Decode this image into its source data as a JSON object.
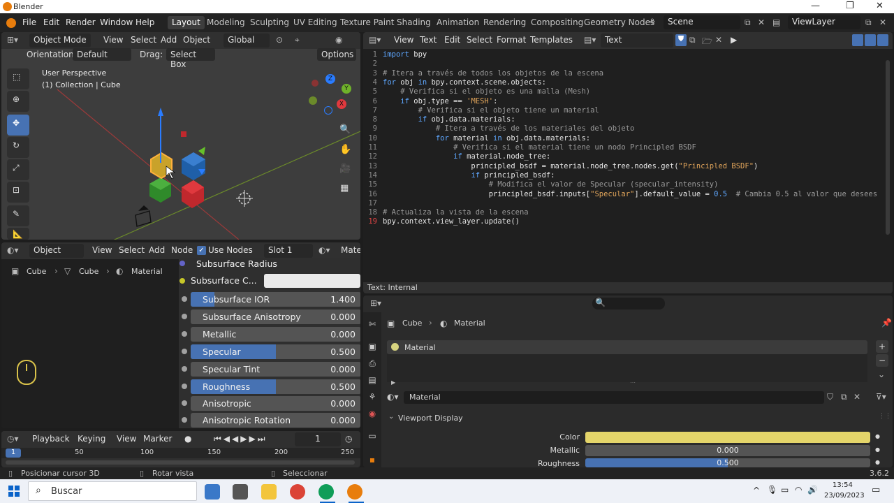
{
  "window": {
    "title": "Blender",
    "minimize": "—",
    "maximize": "❐",
    "close": "✕"
  },
  "topbar": {
    "menus": [
      "File",
      "Edit",
      "Render",
      "Window",
      "Help"
    ],
    "workspaces": [
      "Layout",
      "Modeling",
      "Sculpting",
      "UV Editing",
      "Texture Paint",
      "Shading",
      "Animation",
      "Rendering",
      "Compositing",
      "Geometry Nodes"
    ],
    "scene": "Scene",
    "view_layer": "ViewLayer"
  },
  "viewport": {
    "mode": "Object Mode",
    "menus": [
      "View",
      "Select",
      "Add",
      "Object"
    ],
    "transform": "Global",
    "orientation_label": "Orientation:",
    "orientation": "Default",
    "drag_label": "Drag:",
    "drag": "Select Box",
    "options": "Options",
    "perspective": "User Perspective",
    "collection": "(1) Collection | Cube",
    "gizmo_axes": [
      "Z",
      "Y",
      "X"
    ]
  },
  "text_editor": {
    "menus": [
      "View",
      "Text",
      "Edit",
      "Select",
      "Format",
      "Templates"
    ],
    "datablock": "Text",
    "footer": "Text: Internal",
    "lines": [
      {
        "n": "1",
        "t": "import bpy"
      },
      {
        "n": "2",
        "t": ""
      },
      {
        "n": "3",
        "t": "# Itera a través de todos los objetos de la escena"
      },
      {
        "n": "4",
        "t": "for obj in bpy.context.scene.objects:"
      },
      {
        "n": "5",
        "t": "    # Verifica si el objeto es una malla (Mesh)"
      },
      {
        "n": "6",
        "t": "    if obj.type == 'MESH':"
      },
      {
        "n": "7",
        "t": "        # Verifica si el objeto tiene un material"
      },
      {
        "n": "8",
        "t": "        if obj.data.materials:"
      },
      {
        "n": "9",
        "t": "            # Itera a través de los materiales del objeto"
      },
      {
        "n": "10",
        "t": "            for material in obj.data.materials:"
      },
      {
        "n": "11",
        "t": "                # Verifica si el material tiene un nodo Principled BSDF"
      },
      {
        "n": "12",
        "t": "                if material.node_tree:"
      },
      {
        "n": "13",
        "t": "                    principled_bsdf = material.node_tree.nodes.get(\"Principled BSDF\")"
      },
      {
        "n": "14",
        "t": "                    if principled_bsdf:"
      },
      {
        "n": "15",
        "t": "                        # Modifica el valor de Specular (specular_intensity)"
      },
      {
        "n": "16",
        "t": "                        principled_bsdf.inputs[\"Specular\"].default_value = 0.5  # Cambia 0.5 al valor que desees"
      },
      {
        "n": "17",
        "t": ""
      },
      {
        "n": "18",
        "t": "# Actualiza la vista de la escena"
      },
      {
        "n": "19",
        "t": "bpy.context.view_layer.update()"
      }
    ]
  },
  "node_editor": {
    "object": "Object",
    "menus": [
      "View",
      "Select",
      "Add",
      "Node"
    ],
    "use_nodes": "Use Nodes",
    "slot": "Slot 1",
    "material_short": "Mater",
    "breadcrumb": [
      "Cube",
      "Cube",
      "Material"
    ],
    "subsurface_radius": "Subsurface Radius",
    "subsurface_color": "Subsurface C...",
    "rows": [
      {
        "label": "Subsurface IOR",
        "value": "1.400",
        "fill": 0.14
      },
      {
        "label": "Subsurface Anisotropy",
        "value": "0.000",
        "fill": 0
      },
      {
        "label": "Metallic",
        "value": "0.000",
        "fill": 0
      },
      {
        "label": "Specular",
        "value": "0.500",
        "fill": 0.5
      },
      {
        "label": "Specular Tint",
        "value": "0.000",
        "fill": 0
      },
      {
        "label": "Roughness",
        "value": "0.500",
        "fill": 0.5
      },
      {
        "label": "Anisotropic",
        "value": "0.000",
        "fill": 0
      },
      {
        "label": "Anisotropic Rotation",
        "value": "0.000",
        "fill": 0
      }
    ]
  },
  "properties": {
    "breadcrumb": [
      "Cube",
      "Material"
    ],
    "slot_item": "Material",
    "material_name": "Material",
    "panel": "Viewport Display",
    "color_label": "Color",
    "color_value": "#e4d56a",
    "metallic_label": "Metallic",
    "metallic_value": "0.000",
    "metallic_fill": 0,
    "roughness_label": "Roughness",
    "roughness_value": "0.500",
    "roughness_fill": 0.5
  },
  "timeline": {
    "menus": [
      "Playback",
      "Keying",
      "View",
      "Marker"
    ],
    "frame": "1",
    "ticks": [
      "1",
      "50",
      "100",
      "150",
      "200",
      "250"
    ]
  },
  "status": {
    "hint1": "Posicionar cursor 3D",
    "hint2": "Rotar vista",
    "hint3": "Seleccionar",
    "version": "3.6.2"
  },
  "taskbar": {
    "search": "Buscar",
    "time": "13:54",
    "date": "23/09/2023",
    "tray": "^"
  }
}
